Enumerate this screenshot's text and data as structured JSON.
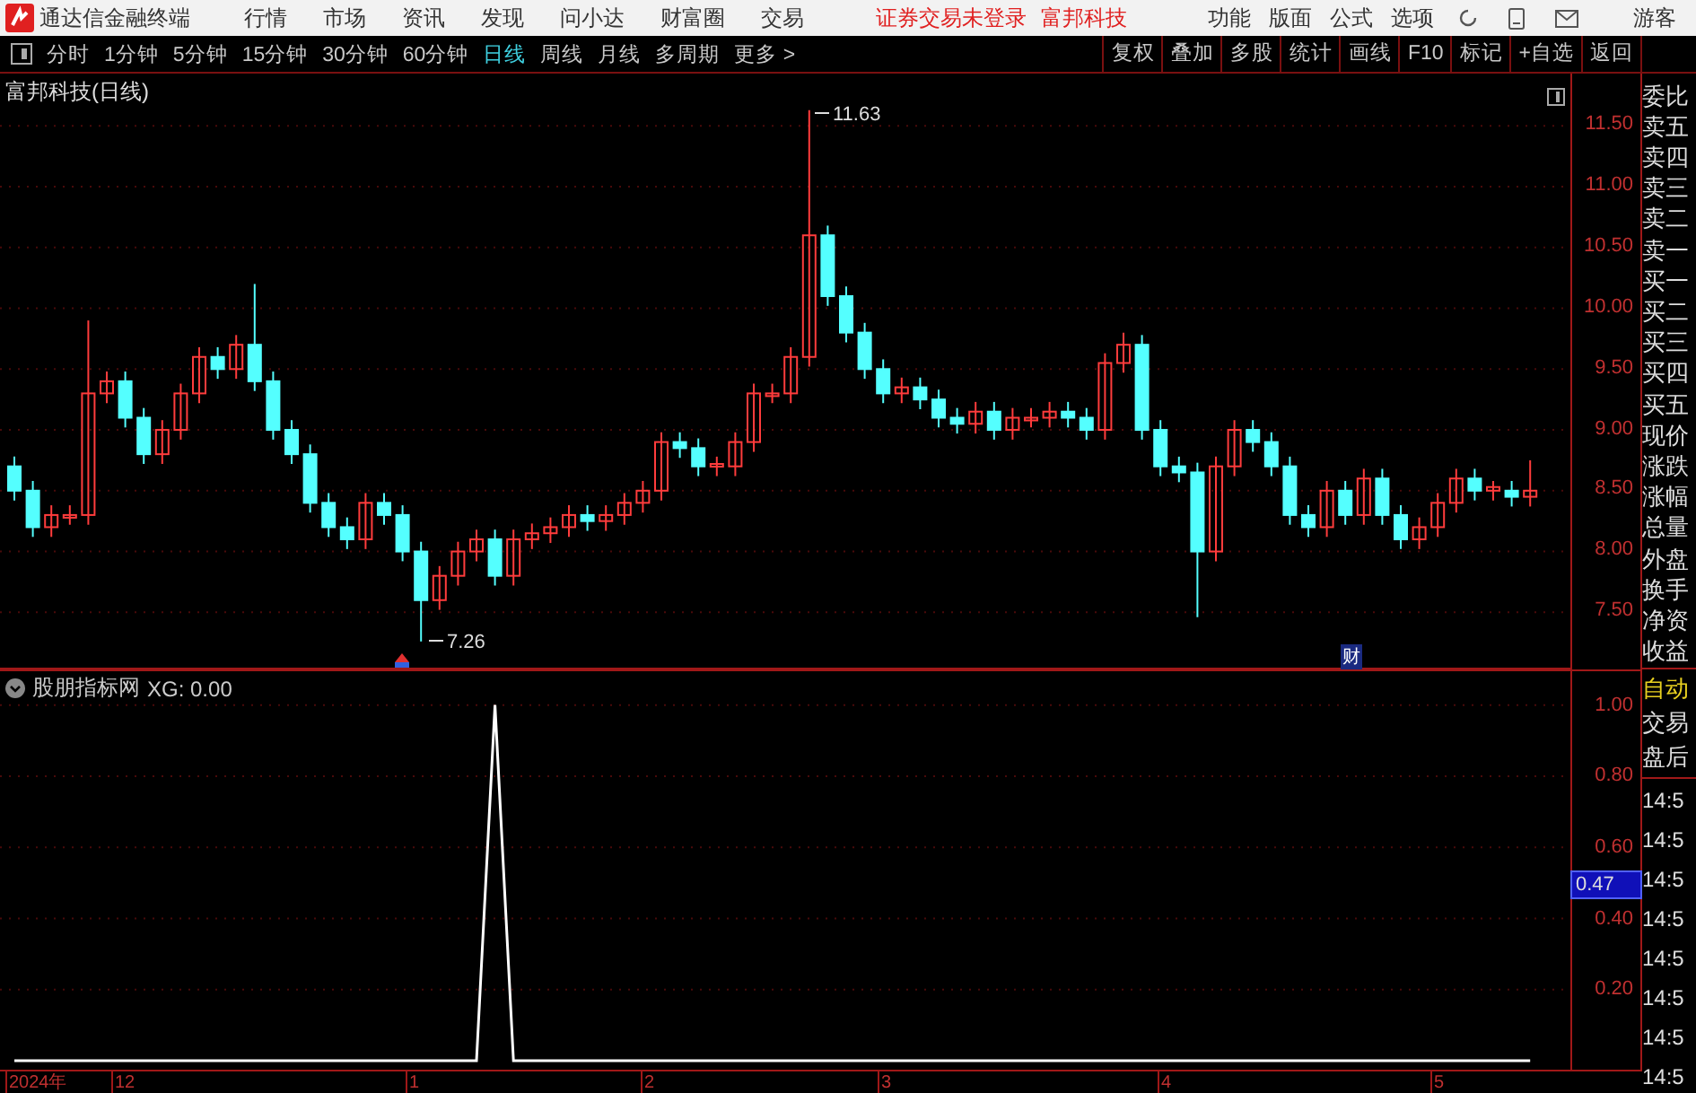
{
  "menu_bar": {
    "app_title": "通达信金融终端",
    "menus": [
      "行情",
      "市场",
      "资讯",
      "发现",
      "问小达",
      "财富圈",
      "交易"
    ],
    "login_status": "证券交易未登录",
    "stock_name": "富邦科技",
    "tools": [
      "功能",
      "版面",
      "公式",
      "选项"
    ],
    "user": "游客"
  },
  "period_tabs": [
    {
      "label": "分时",
      "selected": false
    },
    {
      "label": "1分钟",
      "selected": false
    },
    {
      "label": "5分钟",
      "selected": false
    },
    {
      "label": "15分钟",
      "selected": false
    },
    {
      "label": "30分钟",
      "selected": false
    },
    {
      "label": "60分钟",
      "selected": false
    },
    {
      "label": "日线",
      "selected": true
    },
    {
      "label": "周线",
      "selected": false
    },
    {
      "label": "月线",
      "selected": false
    },
    {
      "label": "多周期",
      "selected": false
    },
    {
      "label": "更多 >",
      "selected": false
    }
  ],
  "tool_buttons": [
    "复权",
    "叠加",
    "多股",
    "统计",
    "画线",
    "F10",
    "标记",
    "+自选",
    "返回"
  ],
  "main_chart": {
    "title": "富邦科技(日线)",
    "high_label": "11.63",
    "low_label": "7.26",
    "event_tag": "财",
    "chart_data": {
      "type": "candlestick",
      "grid": true,
      "ylim": [
        7.03,
        11.93
      ],
      "yticks": [
        {
          "value": 11.5,
          "label": "11.50"
        },
        {
          "value": 11,
          "label": "11.00"
        },
        {
          "value": 10.5,
          "label": "10.50"
        },
        {
          "value": 10,
          "label": "10.00"
        },
        {
          "value": 9.5,
          "label": "9.50"
        },
        {
          "value": 9,
          "label": "9.00"
        },
        {
          "value": 8.5,
          "label": "8.50"
        },
        {
          "value": 8,
          "label": "8.00"
        },
        {
          "value": 7.5,
          "label": "7.50"
        }
      ],
      "ohlc": [
        [
          8.7,
          8.78,
          8.42,
          8.5
        ],
        [
          8.5,
          8.58,
          8.12,
          8.2
        ],
        [
          8.2,
          8.38,
          8.12,
          8.3
        ],
        [
          8.3,
          8.38,
          8.22,
          8.3
        ],
        [
          8.3,
          9.9,
          8.22,
          9.3
        ],
        [
          9.3,
          9.48,
          9.22,
          9.4
        ],
        [
          9.4,
          9.48,
          9.02,
          9.1
        ],
        [
          9.1,
          9.18,
          8.72,
          8.8
        ],
        [
          8.8,
          9.08,
          8.72,
          9.0
        ],
        [
          9.0,
          9.38,
          8.92,
          9.3
        ],
        [
          9.3,
          9.68,
          9.22,
          9.6
        ],
        [
          9.6,
          9.68,
          9.42,
          9.5
        ],
        [
          9.5,
          9.78,
          9.42,
          9.7
        ],
        [
          9.7,
          10.2,
          9.32,
          9.4
        ],
        [
          9.4,
          9.48,
          8.92,
          9.0
        ],
        [
          9.0,
          9.08,
          8.72,
          8.8
        ],
        [
          8.8,
          8.88,
          8.32,
          8.4
        ],
        [
          8.4,
          8.48,
          8.12,
          8.2
        ],
        [
          8.2,
          8.28,
          8.02,
          8.1
        ],
        [
          8.1,
          8.48,
          8.02,
          8.4
        ],
        [
          8.4,
          8.48,
          8.22,
          8.3
        ],
        [
          8.3,
          8.38,
          7.92,
          8.0
        ],
        [
          8.0,
          8.08,
          7.26,
          7.6
        ],
        [
          7.6,
          7.88,
          7.52,
          7.8
        ],
        [
          7.8,
          8.08,
          7.72,
          8.0
        ],
        [
          8.0,
          8.18,
          7.92,
          8.1
        ],
        [
          8.1,
          8.18,
          7.72,
          7.8
        ],
        [
          7.8,
          8.18,
          7.72,
          8.1
        ],
        [
          8.1,
          8.23,
          8.02,
          8.15
        ],
        [
          8.15,
          8.28,
          8.07,
          8.2
        ],
        [
          8.2,
          8.38,
          8.12,
          8.3
        ],
        [
          8.3,
          8.38,
          8.17,
          8.25
        ],
        [
          8.25,
          8.38,
          8.17,
          8.3
        ],
        [
          8.3,
          8.48,
          8.22,
          8.4
        ],
        [
          8.4,
          8.58,
          8.32,
          8.5
        ],
        [
          8.5,
          8.98,
          8.42,
          8.9
        ],
        [
          8.9,
          8.98,
          8.77,
          8.85
        ],
        [
          8.85,
          8.93,
          8.62,
          8.7
        ],
        [
          8.7,
          8.78,
          8.62,
          8.72
        ],
        [
          8.7,
          8.98,
          8.62,
          8.9
        ],
        [
          8.9,
          9.38,
          8.82,
          9.3
        ],
        [
          9.3,
          9.38,
          9.22,
          9.3
        ],
        [
          9.3,
          9.68,
          9.22,
          9.6
        ],
        [
          9.6,
          11.63,
          9.52,
          10.6
        ],
        [
          10.6,
          10.68,
          10.02,
          10.1
        ],
        [
          10.1,
          10.18,
          9.72,
          9.8
        ],
        [
          9.8,
          9.88,
          9.42,
          9.5
        ],
        [
          9.5,
          9.58,
          9.22,
          9.3
        ],
        [
          9.3,
          9.43,
          9.22,
          9.35
        ],
        [
          9.35,
          9.43,
          9.17,
          9.25
        ],
        [
          9.25,
          9.33,
          9.02,
          9.1
        ],
        [
          9.1,
          9.18,
          8.97,
          9.05
        ],
        [
          9.05,
          9.23,
          8.97,
          9.15
        ],
        [
          9.15,
          9.23,
          8.92,
          9.0
        ],
        [
          9.0,
          9.18,
          8.92,
          9.1
        ],
        [
          9.1,
          9.18,
          9.02,
          9.1
        ],
        [
          9.1,
          9.23,
          9.02,
          9.15
        ],
        [
          9.15,
          9.23,
          9.02,
          9.1
        ],
        [
          9.1,
          9.18,
          8.92,
          9.0
        ],
        [
          9.0,
          9.63,
          8.92,
          9.55
        ],
        [
          9.55,
          9.8,
          9.47,
          9.7
        ],
        [
          9.7,
          9.78,
          8.92,
          9.0
        ],
        [
          9.0,
          9.08,
          8.62,
          8.7
        ],
        [
          8.7,
          8.78,
          8.57,
          8.65
        ],
        [
          8.65,
          8.73,
          7.46,
          8.0
        ],
        [
          8.0,
          8.78,
          7.92,
          8.7
        ],
        [
          8.7,
          9.08,
          8.62,
          9.0
        ],
        [
          9.0,
          9.08,
          8.82,
          8.9
        ],
        [
          8.9,
          8.98,
          8.62,
          8.7
        ],
        [
          8.7,
          8.78,
          8.22,
          8.3
        ],
        [
          8.3,
          8.38,
          8.12,
          8.2
        ],
        [
          8.2,
          8.58,
          8.12,
          8.5
        ],
        [
          8.5,
          8.58,
          8.22,
          8.3
        ],
        [
          8.3,
          8.68,
          8.22,
          8.6
        ],
        [
          8.6,
          8.68,
          8.22,
          8.3
        ],
        [
          8.3,
          8.38,
          8.02,
          8.1
        ],
        [
          8.1,
          8.28,
          8.02,
          8.2
        ],
        [
          8.2,
          8.48,
          8.12,
          8.4
        ],
        [
          8.4,
          8.68,
          8.32,
          8.6
        ],
        [
          8.6,
          8.68,
          8.42,
          8.5
        ],
        [
          8.5,
          8.58,
          8.42,
          8.53
        ],
        [
          8.5,
          8.58,
          8.37,
          8.45
        ],
        [
          8.45,
          8.75,
          8.37,
          8.5
        ]
      ]
    }
  },
  "indicator": {
    "title": "股朋指标网",
    "reading": ": 0.00",
    "cursor_value": "0.47",
    "chart_data": {
      "type": "line",
      "grid": true,
      "ylim": [
        -0.025,
        1.1
      ],
      "yticks": [
        {
          "value": 1,
          "label": "1.00"
        },
        {
          "value": 0.8,
          "label": "0.80"
        },
        {
          "value": 0.6,
          "label": "0.60"
        },
        {
          "value": 0.4,
          "label": "0.40"
        },
        {
          "value": 0.2,
          "label": "0.20"
        }
      ],
      "series": [
        {
          "name": "XG",
          "color": "#ffffff",
          "values": [
            0,
            0,
            0,
            0,
            0,
            0,
            0,
            0,
            0,
            0,
            0,
            0,
            0,
            0,
            0,
            0,
            0,
            0,
            0,
            0,
            0,
            0,
            0,
            0,
            0,
            0,
            1,
            0,
            0,
            0,
            0,
            0,
            0,
            0,
            0,
            0,
            0,
            0,
            0,
            0,
            0,
            0,
            0,
            0,
            0,
            0,
            0,
            0,
            0,
            0,
            0,
            0,
            0,
            0,
            0,
            0,
            0,
            0,
            0,
            0,
            0,
            0,
            0,
            0,
            0,
            0,
            0,
            0,
            0,
            0,
            0,
            0,
            0,
            0,
            0,
            0,
            0,
            0,
            0,
            0,
            0,
            0,
            0
          ]
        }
      ]
    }
  },
  "quote_panel": {
    "labels": [
      "委比",
      "卖五",
      "卖四",
      "卖三",
      "卖二",
      "卖一",
      "买一",
      "买二",
      "买三",
      "买四",
      "买五",
      "现价",
      "涨跌",
      "涨幅",
      "总量",
      "外盘",
      "换手",
      "净资",
      "收益"
    ],
    "modes": [
      {
        "label": "自动",
        "selected": true
      },
      {
        "label": "交易",
        "selected": false
      },
      {
        "label": "盘后",
        "selected": false
      }
    ],
    "times": [
      "14:5",
      "14:5",
      "14:5",
      "14:5",
      "14:5",
      "14:5",
      "14:5",
      "14:5"
    ]
  },
  "x_axis": {
    "labels": [
      "2024年",
      "12",
      "1",
      "2",
      "3",
      "4",
      "5"
    ]
  }
}
